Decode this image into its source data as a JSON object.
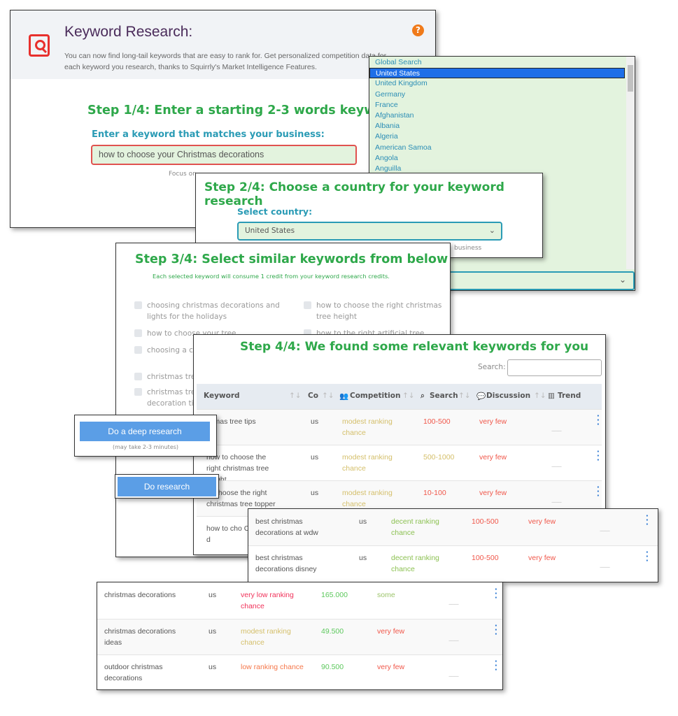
{
  "step1": {
    "title": "Keyword Research:",
    "description": "You can now find long-tail keywords that are easy to rank for. Get personalized competition data for each keyword you research, thanks to Squirrly's Market Intelligence Features.",
    "help_icon": "question-circle-icon",
    "heading": "Step 1/4: Enter a starting 2-3 words keyword",
    "label": "Enter a keyword that matches your business:",
    "keyword_value": "how to choose your Christmas decorations",
    "hint": "Focus on"
  },
  "country_dropdown": {
    "options": [
      "Global Search",
      "United States",
      "United Kingdom",
      "Germany",
      "France",
      "Afghanistan",
      "Albania",
      "Algeria",
      "American Samoa",
      "Angola",
      "Anguilla"
    ],
    "selected": "United States",
    "chevron": "⌄"
  },
  "step2": {
    "heading": "Step 2/4: Choose a country for your keyword research",
    "label": "Select country:",
    "selected": "United States",
    "chevron": "⌄",
    "hint": "business"
  },
  "step3": {
    "heading": "Step 3/4: Select similar keywords from below",
    "subtitle": "Each selected keyword will consume 1 credit from your keyword research credits.",
    "options": [
      "choosing christmas decorations and lights for the holidays",
      "how to choose the right christmas tree height",
      "how to choose your tree",
      "how to the right artificial tree",
      "choosing a ch",
      "christmas tre",
      "christmas tre decoration tip"
    ]
  },
  "buttons": {
    "deep_research": "Do a deep research",
    "deep_note": "(may take 2-3 minutes)",
    "do_research": "Do research"
  },
  "step4": {
    "heading": "Step 4/4: We found some relevant keywords for you",
    "search_label": "Search:",
    "search_value": "",
    "columns": [
      "Keyword",
      "Co",
      "Competition",
      "Search",
      "Discussion",
      "Trend"
    ],
    "sort_icon": "↑↓",
    "rows": [
      {
        "keyword": "istmas tree tips",
        "country": "us",
        "competition": "modest ranking chance",
        "search": "100-500",
        "discussion": "very few"
      },
      {
        "keyword": "how to choose the right christmas tree height",
        "country": "us",
        "competition": "modest ranking chance",
        "search": "500-1000",
        "discussion": "very few"
      },
      {
        "keyword": "to choose the right christmas tree topper",
        "country": "us",
        "competition": "modest ranking chance",
        "search": "10-100",
        "discussion": "very few"
      },
      {
        "keyword": "how to cho Christmas d",
        "country": "",
        "competition": "",
        "search": "",
        "discussion": ""
      }
    ]
  },
  "results_b": {
    "rows": [
      {
        "keyword": "best christmas decorations at wdw",
        "country": "us",
        "competition": "decent ranking chance",
        "search": "100-500",
        "discussion": "very few"
      },
      {
        "keyword": "best christmas decorations disney",
        "country": "us",
        "competition": "decent ranking chance",
        "search": "100-500",
        "discussion": "very few"
      }
    ]
  },
  "results_c": {
    "rows": [
      {
        "keyword": "christmas decorations",
        "country": "us",
        "competition": "very low ranking chance",
        "search": "165.000",
        "discussion": "some"
      },
      {
        "keyword": "christmas decorations ideas",
        "country": "us",
        "competition": "modest ranking chance",
        "search": "49.500",
        "discussion": "very few"
      },
      {
        "keyword": "outdoor christmas decorations",
        "country": "us",
        "competition": "low ranking chance",
        "search": "90.500",
        "discussion": "very few"
      }
    ]
  },
  "colors": {
    "heading_green": "#2ea84a",
    "label_teal": "#2a9bb5",
    "button_blue": "#5b9ee6",
    "modest ranking chance": "#d4bf6a",
    "decent ranking chance": "#8cc152",
    "very low ranking chance": "#f0325a",
    "low ranking chance": "#f5774a",
    "very few": "#f0574a",
    "some": "#9cc46a",
    "100-500": "#f0574a",
    "10-100": "#f0574a",
    "500-1000": "#d4bf6a",
    "165.000": "#5cc85c",
    "49.500": "#5cc85c",
    "90.500": "#5cc85c"
  }
}
